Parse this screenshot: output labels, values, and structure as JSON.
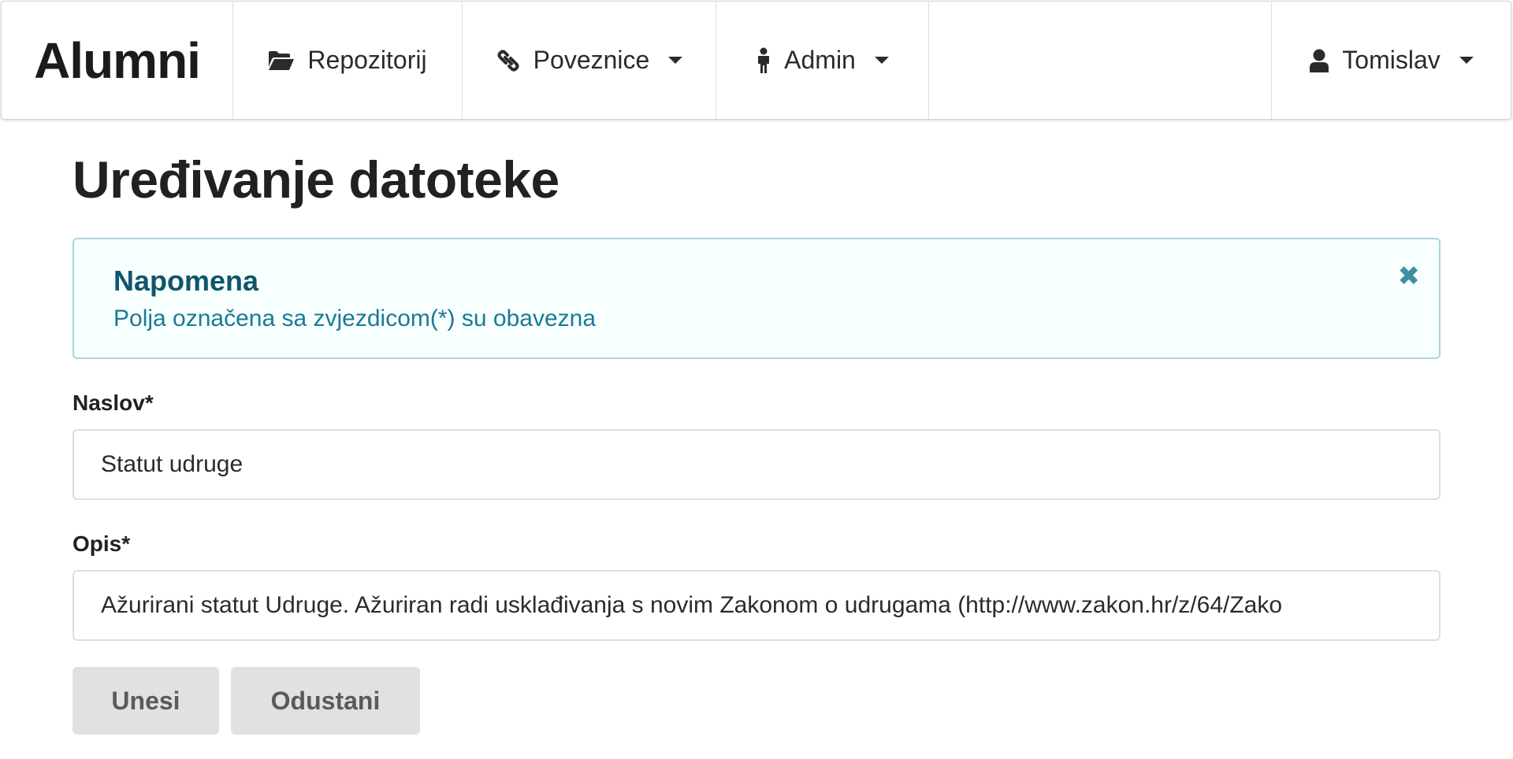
{
  "menu": {
    "brand": "Alumni",
    "repository": {
      "label": "Repozitorij",
      "icon": "folder-open-icon"
    },
    "links": {
      "label": "Poveznice",
      "icon": "chain-link-icon"
    },
    "admin": {
      "label": "Admin",
      "icon": "person-icon"
    },
    "user": {
      "label": "Tomislav",
      "icon": "user-icon"
    }
  },
  "page": {
    "title": "Uređivanje datoteke"
  },
  "notice": {
    "header": "Napomena",
    "text": "Polja označena sa zvjezdicom(*) su obavezna",
    "close_symbol": "✖"
  },
  "form": {
    "title_label": "Naslov*",
    "title_value": "Statut udruge",
    "description_label": "Opis*",
    "description_value": "Ažurirani statut Udruge. Ažuriran radi usklađivanja s novim Zakonom o udrugama (http://www.zakon.hr/z/64/Zako"
  },
  "buttons": {
    "submit": "Unesi",
    "cancel": "Odustani"
  },
  "colors": {
    "notice_background": "#f8ffff",
    "notice_border": "#a9d5de",
    "notice_header": "#0e566c",
    "notice_text": "#1a7a94",
    "button_background": "#e0e1e2"
  }
}
